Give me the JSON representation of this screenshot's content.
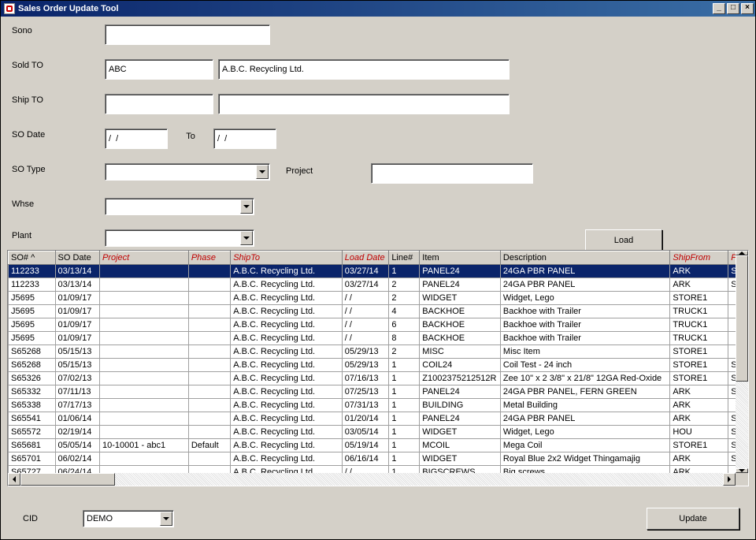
{
  "window": {
    "title": "Sales Order Update Tool"
  },
  "winbtns": {
    "min": "_",
    "max": "□",
    "close": "×"
  },
  "form": {
    "sono_label": "Sono",
    "sono_value": "",
    "soldto_label": "Sold TO",
    "soldto_code": "ABC",
    "soldto_name": "A.B.C. Recycling Ltd.",
    "shipto_label": "Ship TO",
    "shipto_code": "",
    "shipto_name": "",
    "sodate_label": "SO Date",
    "sodate_from": "/  /",
    "sodate_to_label": "To",
    "sodate_to": "/  /",
    "sotype_label": "SO Type",
    "sotype_value": "",
    "project_label": "Project",
    "project_value": "",
    "whse_label": "Whse",
    "whse_value": "",
    "plant_label": "Plant",
    "plant_value": "",
    "load_btn": "Load"
  },
  "grid": {
    "columns": [
      {
        "key": "so",
        "label": "SO# ^",
        "editable": false
      },
      {
        "key": "sodate",
        "label": "SO Date",
        "editable": false
      },
      {
        "key": "project",
        "label": "Project",
        "editable": true
      },
      {
        "key": "phase",
        "label": "Phase",
        "editable": true
      },
      {
        "key": "shipto",
        "label": "ShipTo",
        "editable": true
      },
      {
        "key": "loaddate",
        "label": "Load Date",
        "editable": true
      },
      {
        "key": "line",
        "label": "Line#",
        "editable": false
      },
      {
        "key": "item",
        "label": "Item",
        "editable": false
      },
      {
        "key": "desc",
        "label": "Description",
        "editable": false
      },
      {
        "key": "shipfrom",
        "label": "ShipFrom",
        "editable": true
      },
      {
        "key": "plant",
        "label": "Pla",
        "editable": true
      }
    ],
    "rows": [
      {
        "so": "112233",
        "sodate": "03/13/14",
        "project": "",
        "phase": "",
        "shipto": "A.B.C. Recycling Ltd.",
        "loaddate": "03/27/14",
        "line": "1",
        "item": "PANEL24",
        "desc": "24GA PBR PANEL",
        "shipfrom": "ARK",
        "plant": "ST"
      },
      {
        "so": "112233",
        "sodate": "03/13/14",
        "project": "",
        "phase": "",
        "shipto": "A.B.C. Recycling Ltd.",
        "loaddate": "03/27/14",
        "line": "2",
        "item": "PANEL24",
        "desc": "24GA PBR PANEL",
        "shipfrom": "ARK",
        "plant": "ST"
      },
      {
        "so": "J5695",
        "sodate": "01/09/17",
        "project": "",
        "phase": "",
        "shipto": "A.B.C. Recycling Ltd.",
        "loaddate": "/  /",
        "line": "2",
        "item": "WIDGET",
        "desc": "Widget, Lego",
        "shipfrom": "STORE1",
        "plant": ""
      },
      {
        "so": "J5695",
        "sodate": "01/09/17",
        "project": "",
        "phase": "",
        "shipto": "A.B.C. Recycling Ltd.",
        "loaddate": "/  /",
        "line": "4",
        "item": "BACKHOE",
        "desc": "Backhoe with Trailer",
        "shipfrom": "TRUCK1",
        "plant": ""
      },
      {
        "so": "J5695",
        "sodate": "01/09/17",
        "project": "",
        "phase": "",
        "shipto": "A.B.C. Recycling Ltd.",
        "loaddate": "/  /",
        "line": "6",
        "item": "BACKHOE",
        "desc": "Backhoe with Trailer",
        "shipfrom": "TRUCK1",
        "plant": ""
      },
      {
        "so": "J5695",
        "sodate": "01/09/17",
        "project": "",
        "phase": "",
        "shipto": "A.B.C. Recycling Ltd.",
        "loaddate": "/  /",
        "line": "8",
        "item": "BACKHOE",
        "desc": "Backhoe with Trailer",
        "shipfrom": "TRUCK1",
        "plant": ""
      },
      {
        "so": "S65268",
        "sodate": "05/15/13",
        "project": "",
        "phase": "",
        "shipto": "A.B.C. Recycling Ltd.",
        "loaddate": "05/29/13",
        "line": "2",
        "item": "MISC",
        "desc": "Misc Item",
        "shipfrom": "STORE1",
        "plant": ""
      },
      {
        "so": "S65268",
        "sodate": "05/15/13",
        "project": "",
        "phase": "",
        "shipto": "A.B.C. Recycling Ltd.",
        "loaddate": "05/29/13",
        "line": "1",
        "item": "COIL24",
        "desc": "Coil Test - 24 inch",
        "shipfrom": "STORE1",
        "plant": "ST"
      },
      {
        "so": "S65326",
        "sodate": "07/02/13",
        "project": "",
        "phase": "",
        "shipto": "A.B.C. Recycling Ltd.",
        "loaddate": "07/16/13",
        "line": "1",
        "item": "Z1002375212512R",
        "desc": "Zee 10\" x 2 3/8\" x 21/8\" 12GA Red-Oxide",
        "shipfrom": "STORE1",
        "plant": "ST"
      },
      {
        "so": "S65332",
        "sodate": "07/11/13",
        "project": "",
        "phase": "",
        "shipto": "A.B.C. Recycling Ltd.",
        "loaddate": "07/25/13",
        "line": "1",
        "item": "PANEL24",
        "desc": "24GA PBR PANEL, FERN GREEN",
        "shipfrom": "ARK",
        "plant": "ST"
      },
      {
        "so": "S65338",
        "sodate": "07/17/13",
        "project": "",
        "phase": "",
        "shipto": "A.B.C. Recycling Ltd.",
        "loaddate": "07/31/13",
        "line": "1",
        "item": "BUILDING",
        "desc": "Metal Building",
        "shipfrom": "ARK",
        "plant": ""
      },
      {
        "so": "S65541",
        "sodate": "01/06/14",
        "project": "",
        "phase": "",
        "shipto": "A.B.C. Recycling Ltd.",
        "loaddate": "01/20/14",
        "line": "1",
        "item": "PANEL24",
        "desc": "24GA PBR PANEL",
        "shipfrom": "ARK",
        "plant": "ST"
      },
      {
        "so": "S65572",
        "sodate": "02/19/14",
        "project": "",
        "phase": "",
        "shipto": "A.B.C. Recycling Ltd.",
        "loaddate": "03/05/14",
        "line": "1",
        "item": "WIDGET",
        "desc": "Widget, Lego",
        "shipfrom": "HOU",
        "plant": "ST"
      },
      {
        "so": "S65681",
        "sodate": "05/05/14",
        "project": "10-10001 - abc1",
        "phase": "Default",
        "shipto": "A.B.C. Recycling Ltd.",
        "loaddate": "05/19/14",
        "line": "1",
        "item": "MCOIL",
        "desc": "Mega Coil",
        "shipfrom": "STORE1",
        "plant": "ST"
      },
      {
        "so": "S65701",
        "sodate": "06/02/14",
        "project": "",
        "phase": "",
        "shipto": "A.B.C. Recycling Ltd.",
        "loaddate": "06/16/14",
        "line": "1",
        "item": "WIDGET",
        "desc": "Royal Blue 2x2 Widget Thingamajig",
        "shipfrom": "ARK",
        "plant": "ST"
      },
      {
        "so": "S65727",
        "sodate": "06/24/14",
        "project": "",
        "phase": "",
        "shipto": "A.B.C. Recycling Ltd.",
        "loaddate": "/  /",
        "line": "1",
        "item": "BIGSCREWS",
        "desc": "Big screws",
        "shipfrom": "ARK",
        "plant": ""
      }
    ]
  },
  "bottom": {
    "cid_label": "CID",
    "cid_value": "DEMO",
    "update_btn": "Update"
  }
}
